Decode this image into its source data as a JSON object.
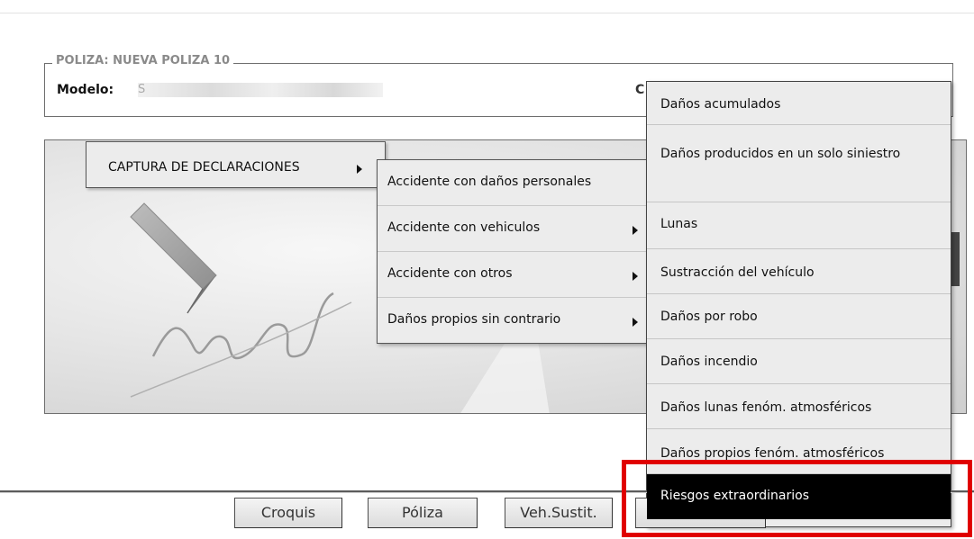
{
  "poliza": {
    "legend": "POLIZA: NUEVA POLIZA 10",
    "modelo_label": "Modelo:",
    "modelo_value": "S",
    "right_fragment": "C"
  },
  "menu": {
    "main_label": "CAPTURA DE DECLARACIONES",
    "submenu": [
      "Accidente con daños personales",
      "Accidente con vehiculos",
      "Accidente con otros",
      "Daños propios sin contrario"
    ],
    "options": [
      "Daños acumulados",
      "Daños producidos en un solo siniestro",
      "Lunas",
      "Sustracción del vehículo",
      "Daños por robo",
      "Daños incendio",
      "Daños lunas fenóm. atmosféricos",
      "Daños propios fenóm. atmosféricos",
      "Riesgos extraordinarios"
    ],
    "selected_index": 8
  },
  "buttons": {
    "croquis": "Croquis",
    "poliza": "Póliza",
    "veh_sustit": "Veh.Sustit."
  },
  "colors": {
    "highlight": "#e00000",
    "selected_bg": "#000000",
    "menu_bg": "#ececec"
  }
}
